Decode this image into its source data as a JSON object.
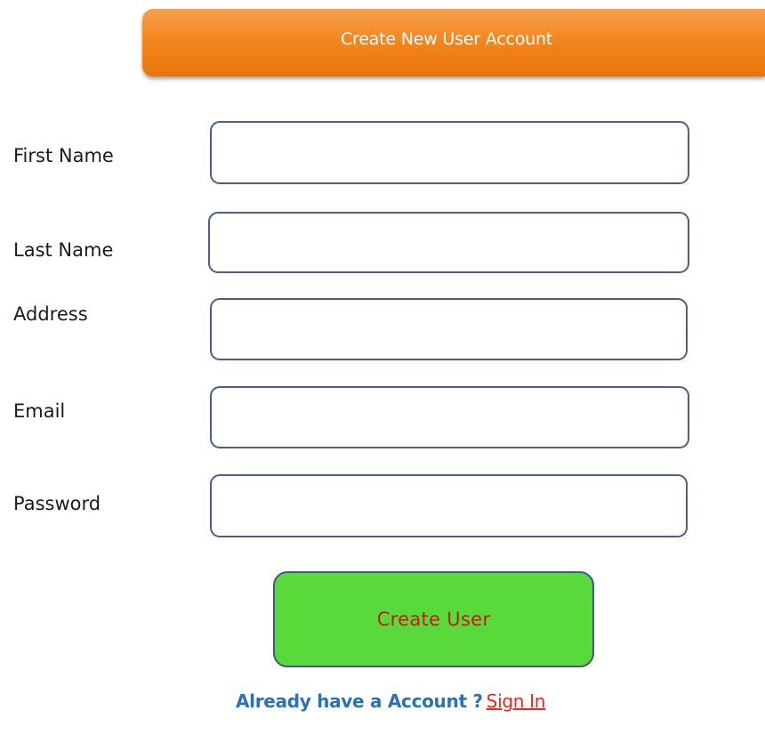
{
  "header": {
    "title": "Create New User Account"
  },
  "form": {
    "fields": [
      {
        "label": "First Name",
        "value": "",
        "placeholder": ""
      },
      {
        "label": "Last Name",
        "value": "",
        "placeholder": ""
      },
      {
        "label": "Address",
        "value": "",
        "placeholder": ""
      },
      {
        "label": "Email",
        "value": "",
        "placeholder": ""
      },
      {
        "label": "Password",
        "value": "",
        "placeholder": ""
      }
    ],
    "submit_label": "Create User"
  },
  "footer": {
    "prompt_text": "Already have a Account ?",
    "link_text": "Sign In"
  },
  "colors": {
    "header_orange": "#f3871f",
    "button_green": "#5ad93b",
    "button_text_red": "#b52612",
    "input_border": "#4a5f8a",
    "prompt_blue": "#2a72b5",
    "link_red": "#e8261c"
  }
}
